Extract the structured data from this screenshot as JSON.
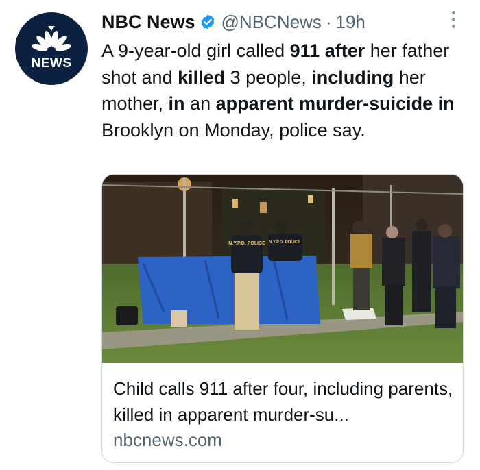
{
  "tweet": {
    "author_name": "NBC News",
    "handle": "@NBCNews",
    "separator": "·",
    "time": "19h",
    "avatar_text": "NEWS",
    "text_segments": [
      {
        "t": "A 9-year-old girl called ",
        "b": false
      },
      {
        "t": "911 after",
        "b": true
      },
      {
        "t": " her father shot and ",
        "b": false
      },
      {
        "t": "killed",
        "b": true
      },
      {
        "t": " 3 people, ",
        "b": false
      },
      {
        "t": "including",
        "b": true
      },
      {
        "t": " her mother, ",
        "b": false
      },
      {
        "t": "in",
        "b": true
      },
      {
        "t": " an ",
        "b": false
      },
      {
        "t": "apparent murder-suicide in",
        "b": true
      },
      {
        "t": " Brooklyn on Monday, police say.",
        "b": false
      }
    ]
  },
  "card": {
    "title": "Child calls 911 after four, including parents, killed in apparent murder-su...",
    "domain": "nbcnews.com",
    "image_labels": {
      "jacket_left": "N.Y.P.D. POLICE",
      "jacket_right": "N.Y.P.D. POLICE"
    }
  },
  "icons": {
    "verified": "verified-badge-icon",
    "more": "more-vertical-icon",
    "peacock": "peacock-logo-icon"
  },
  "colors": {
    "text": "#0f1419",
    "secondary": "#536471",
    "verified_blue": "#1d9bf0",
    "avatar_bg": "#0c2140",
    "tarp_blue": "#2d63c4"
  }
}
